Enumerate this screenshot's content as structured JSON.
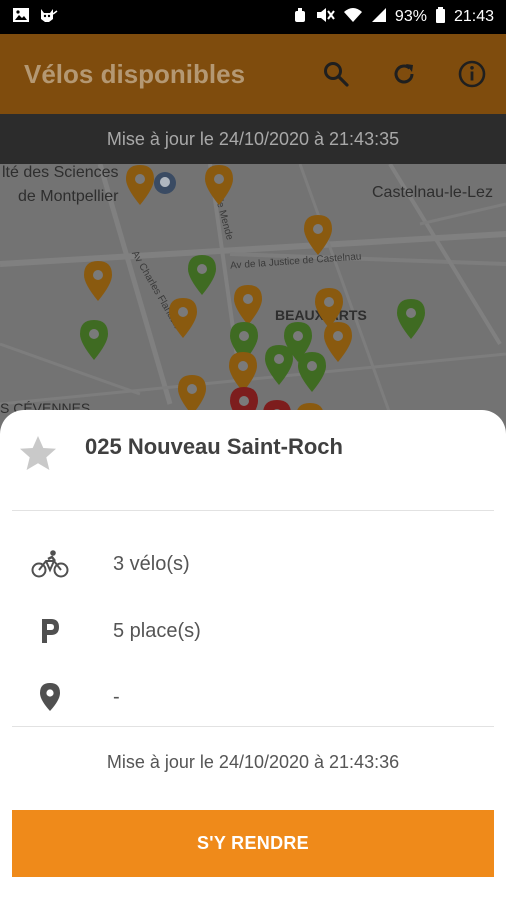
{
  "status_bar": {
    "battery": "93%",
    "time": "21:43"
  },
  "app_bar": {
    "title": "Vélos disponibles"
  },
  "banner": {
    "text": "Mise à jour le 24/10/2020 à 21:43:35"
  },
  "map": {
    "labels": {
      "faculty_line1": "lté des Sciences",
      "faculty_line2": "de Montpellier",
      "castelnau": "Castelnau-le-Lez",
      "beaux_arts": "BEAUX-ARTS",
      "cevennes": "S CÉVENNES",
      "street_justice": "Av de la Justice de Castelnau",
      "street_chartrous": "Av Charles Flahault",
      "street_ecole": "Rte de Mende"
    },
    "pin_colors": {
      "orange": "#8a5a0f",
      "green": "#3f6b22",
      "red": "#7d1d1d"
    }
  },
  "station": {
    "name": "025 Nouveau Saint-Roch",
    "bikes": "3 vélo(s)",
    "places": "5 place(s)",
    "address": "-",
    "updated": "Mise à jour le 24/10/2020 à 21:43:36",
    "action_label": "S'Y RENDRE"
  },
  "colors": {
    "accent": "#ef8a1a",
    "appbar_dimmed": "#7f4c0d"
  }
}
